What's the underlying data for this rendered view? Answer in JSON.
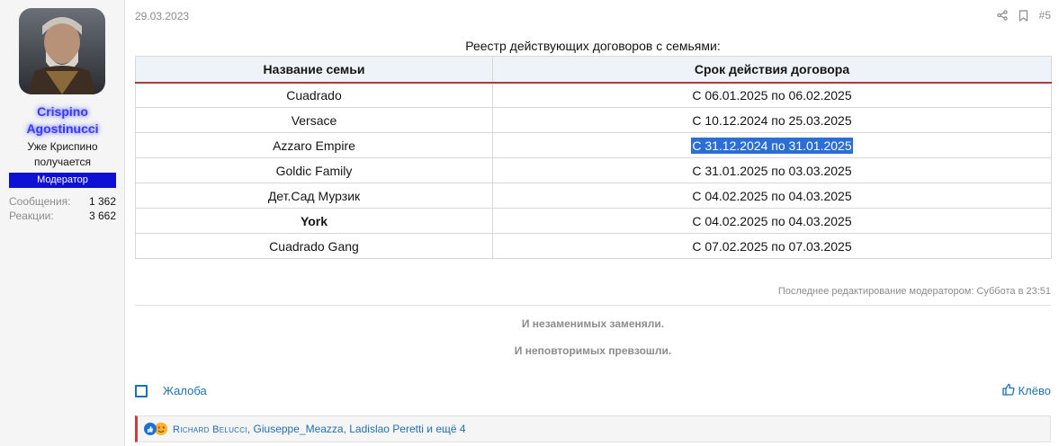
{
  "user": {
    "name": "Crispino Agostinucci",
    "name_line1": "Crispino",
    "name_line2": "Agostinucci",
    "title_line1": "Уже Криспино",
    "title_line2": "получается",
    "role": "Модератор",
    "stats": [
      {
        "label": "Сообщения:",
        "value": "1 362"
      },
      {
        "label": "Реакции:",
        "value": "3 662"
      }
    ]
  },
  "post": {
    "date": "29.03.2023",
    "number": "#5",
    "share_icon": "share-icon",
    "bookmark_icon": "bookmark-icon",
    "table_caption": "Реестр действующих договоров с семьями:",
    "table": {
      "headers": [
        "Название семьи",
        "Срок действия договора"
      ],
      "rows": [
        {
          "family": "Cuadrado",
          "term": "С 06.01.2025 по 06.02.2025"
        },
        {
          "family": "Versace",
          "term": "С 10.12.2024 по 25.03.2025"
        },
        {
          "family": "Azzaro Empire",
          "term": "С 31.12.2024 по 31.01.2025"
        },
        {
          "family": "Goldic Family",
          "term": "С 31.01.2025 по 03.03.2025"
        },
        {
          "family": "Дет.Сад Мурзик",
          "term": "С 04.02.2025 по 04.03.2025"
        },
        {
          "family": "York",
          "term": "С 04.02.2025 по 04.03.2025"
        },
        {
          "family": "Cuadrado Gang",
          "term": "С 07.02.2025 по 07.03.2025"
        }
      ]
    },
    "edit_note": "Последнее редактирование модератором: Суббота в 23:51",
    "signature": [
      "И незаменимых заменяли.",
      "И неповторимых превзошли."
    ],
    "report_label": "Жалоба",
    "like_label": "Клёво",
    "reactions": {
      "first": "Richard Belucci",
      "rest": ", Giuseppe_Meazza, Ladislao Peretti и ещё 4"
    }
  },
  "colors": {
    "username": "#3a3aff",
    "role_badge": "#0f10d6",
    "link": "#1e6fb5",
    "selection": "#2b6ed6",
    "header_border": "#a63c3c"
  }
}
